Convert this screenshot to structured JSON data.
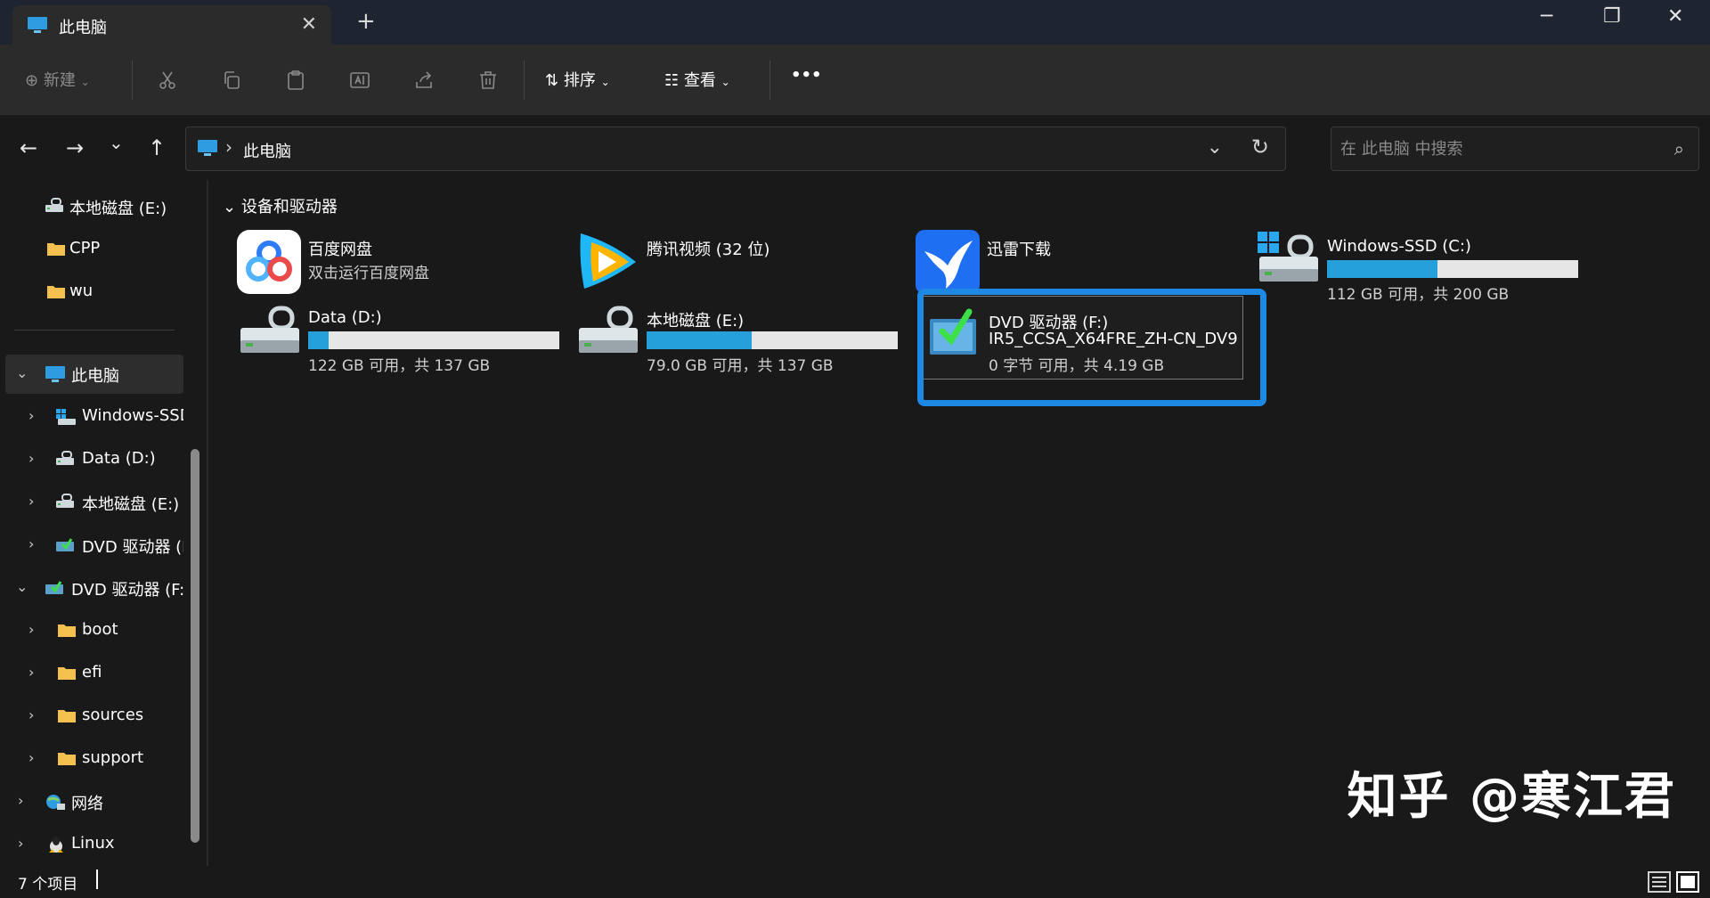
{
  "window": {
    "tab_title": "此电脑",
    "tab_close": "✕",
    "new_tab": "+",
    "minimize": "─",
    "restore": "❐",
    "close": "✕"
  },
  "toolbar": {
    "new_label": "新建",
    "sort_label": "排序",
    "view_label": "查看",
    "more_label": "•••",
    "icons": [
      "cut-icon",
      "copy-icon",
      "paste-icon",
      "rename-icon",
      "share-icon",
      "delete-icon"
    ]
  },
  "nav": {
    "back": "←",
    "forward": "→",
    "recent": "⌄",
    "up": "↑",
    "address_sep": "›",
    "address": "此电脑",
    "address_dropdown": "⌄",
    "refresh": "↻",
    "search_placeholder": "在 此电脑 中搜索",
    "search_icon": "⌕"
  },
  "sidebar": {
    "pinned": [
      {
        "label": "本地磁盘 (E:)",
        "icon": "drive-icon"
      },
      {
        "label": "CPP",
        "icon": "folder-icon"
      },
      {
        "label": "wu",
        "icon": "folder-icon"
      }
    ],
    "tree": [
      {
        "label": "此电脑",
        "chevron": "⌄",
        "icon": "computer-icon",
        "selected": true
      },
      {
        "label": "Windows-SSD",
        "chevron": "›",
        "icon": "windows-drive-icon"
      },
      {
        "label": "Data (D:)",
        "chevron": "›",
        "icon": "drive-icon"
      },
      {
        "label": "本地磁盘 (E:)",
        "chevron": "›",
        "icon": "drive-icon"
      },
      {
        "label": "DVD 驱动器 (F",
        "chevron": "›",
        "icon": "dvd-icon"
      },
      {
        "label": "DVD 驱动器 (F:)",
        "chevron": "⌄",
        "icon": "dvd-icon"
      },
      {
        "label": "boot",
        "chevron": "›",
        "icon": "folder-icon"
      },
      {
        "label": "efi",
        "chevron": "›",
        "icon": "folder-icon"
      },
      {
        "label": "sources",
        "chevron": "›",
        "icon": "folder-icon"
      },
      {
        "label": "support",
        "chevron": "›",
        "icon": "folder-icon"
      },
      {
        "label": "网络",
        "chevron": "›",
        "icon": "network-icon"
      },
      {
        "label": "Linux",
        "chevron": "›",
        "icon": "linux-icon"
      }
    ]
  },
  "main": {
    "group_chevron": "⌄",
    "group_title": "设备和驱动器",
    "apps": [
      {
        "name": "百度网盘",
        "sub": "双击运行百度网盘"
      },
      {
        "name": "腾讯视频 (32 位)"
      },
      {
        "name": "迅雷下载"
      }
    ],
    "drives": [
      {
        "name": "Windows-SSD (C:)",
        "free": "112 GB 可用，共 200 GB",
        "used_fraction": 0.44
      },
      {
        "name": "Data (D:)",
        "free": "122 GB 可用，共 137 GB",
        "used_fraction": 0.08
      },
      {
        "name": "本地磁盘 (E:)",
        "free": "79.0 GB 可用，共 137 GB",
        "used_fraction": 0.42
      }
    ],
    "dvd": {
      "name": "DVD 驱动器 (F:)",
      "label": "IR5_CCSA_X64FRE_ZH-CN_DV9",
      "free": "0 字节 可用，共 4.19 GB"
    },
    "watermark": "知乎 @寒江君"
  },
  "status": {
    "count": "7 个项目"
  },
  "colors": {
    "accent": "#1e88e5",
    "bar_fill": "#26a0da",
    "folder": "#f4c04e"
  }
}
